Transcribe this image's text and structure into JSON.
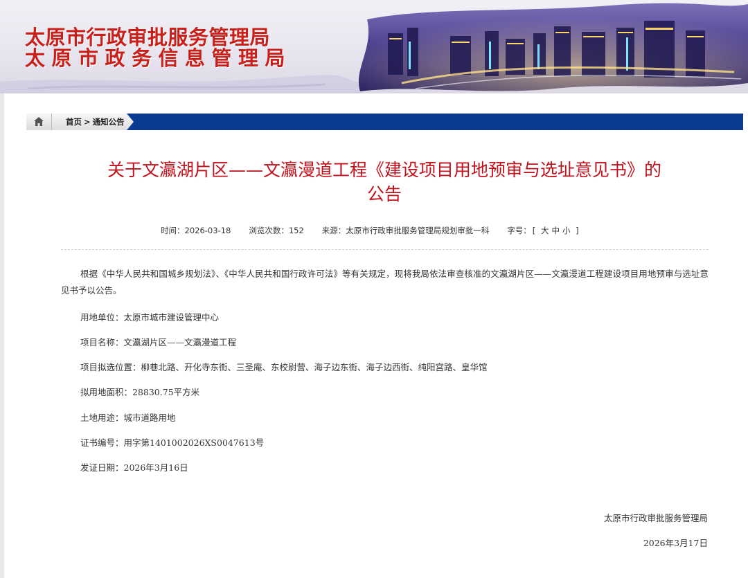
{
  "header": {
    "title_line1": "太原市行政审批服务管理局",
    "title_line2": "太原市政务信息管理局"
  },
  "breadcrumb": {
    "home": "首页",
    "separator": ">",
    "current": "通知公告"
  },
  "article": {
    "title_line1": "关于文瀛湖片区——文瀛漫道工程《建设项目用地预审与选址意见书》的",
    "title_line2": "公告",
    "meta": {
      "time_label": "时间：",
      "time_value": "2026-03-18",
      "views_label": "浏览次数：",
      "views_value": "152",
      "source_label": "来源：",
      "source_value": "太原市行政审批服务管理局规划审批一科",
      "fontsize_label": "字号：",
      "bracket_open": "[",
      "size_large": "大",
      "size_medium": "中",
      "size_small": "小",
      "bracket_close": "]"
    },
    "intro": "根据《中华人民共和国城乡规划法》、《中华人民共和国行政许可法》等有关规定，现将我局依法审查核准的文瀛湖片区——文瀛漫道工程建设项目用地预审与选址意见书予以公告。",
    "fields": [
      "用地单位：太原市城市建设管理中心",
      "项目名称：文瀛湖片区——文瀛漫道工程",
      "项目拟选位置：柳巷北路、开化寺东街、三圣庵、东校尉营、海子边东街、海子边西街、纯阳宫路、皇华馆",
      "拟用地面积：28830.75平方米",
      "土地用途：城市道路用地",
      "证书编号：用字第1401002026XS0047613号",
      "发证日期：2026年3月16日"
    ],
    "signature": "太原市行政审批服务管理局",
    "date": "2026年3月17日"
  },
  "colors": {
    "title_red": "#c8201a",
    "article_title_red": "#c0121c",
    "nav_blue": "#0b3a93"
  }
}
